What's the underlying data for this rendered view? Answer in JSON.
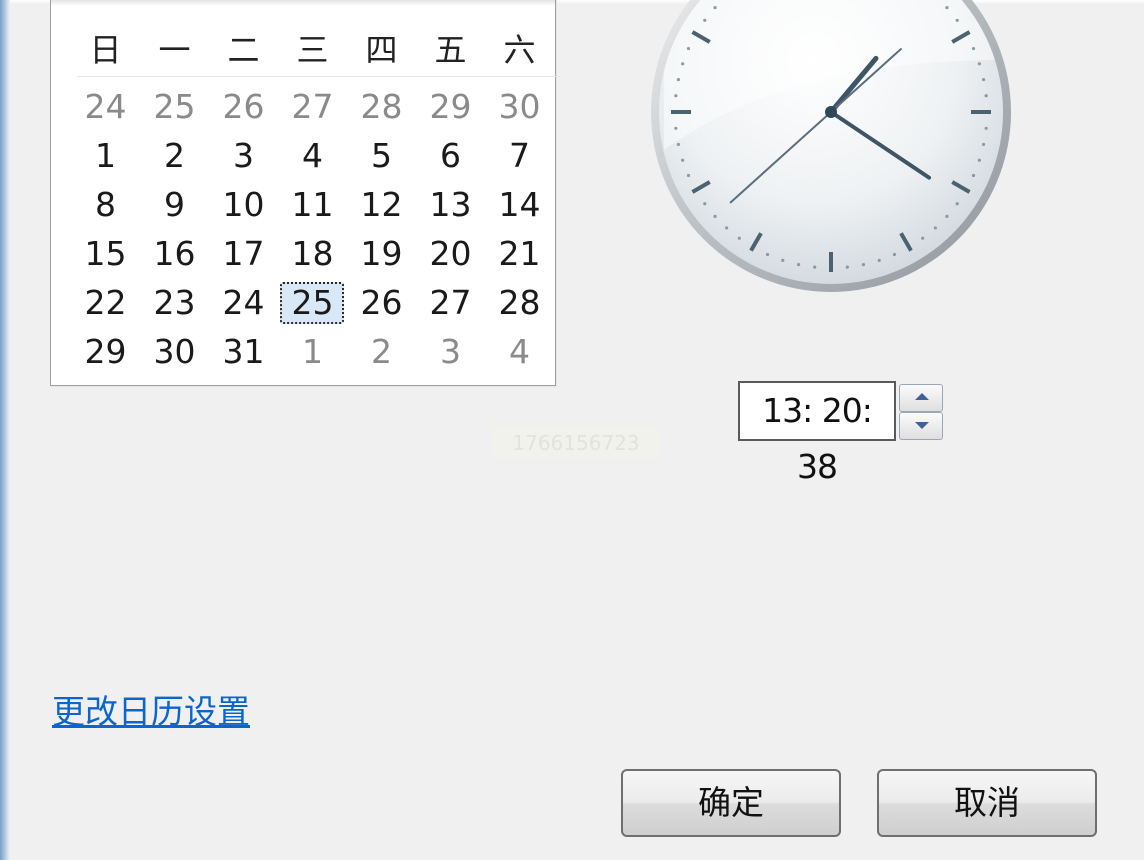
{
  "calendar": {
    "weekdays": [
      "日",
      "一",
      "二",
      "三",
      "四",
      "五",
      "六"
    ],
    "weeks": [
      [
        "24",
        "25",
        "26",
        "27",
        "28",
        "29",
        "30"
      ],
      [
        "1",
        "2",
        "3",
        "4",
        "5",
        "6",
        "7"
      ],
      [
        "8",
        "9",
        "10",
        "11",
        "12",
        "13",
        "14"
      ],
      [
        "15",
        "16",
        "17",
        "18",
        "19",
        "20",
        "21"
      ],
      [
        "22",
        "23",
        "24",
        "25",
        "26",
        "27",
        "28"
      ],
      [
        "29",
        "30",
        "31",
        "1",
        "2",
        "3",
        "4"
      ]
    ],
    "selected_day": "25"
  },
  "clock": {
    "icon": "analog-clock-icon",
    "hour": 13,
    "minute": 20,
    "second": 38
  },
  "time": {
    "value": "13: 20: 38",
    "spin_up_icon": "chevron-up-icon",
    "spin_down_icon": "chevron-down-icon"
  },
  "watermark": {
    "text": "1766156723"
  },
  "links": {
    "change_calendar_settings": "更改日历设置"
  },
  "buttons": {
    "ok": "确定",
    "cancel": "取消"
  },
  "colors": {
    "background": "#f0f0f0",
    "link": "#0a66cc",
    "selected_day_fill": "#d8e8f7"
  }
}
